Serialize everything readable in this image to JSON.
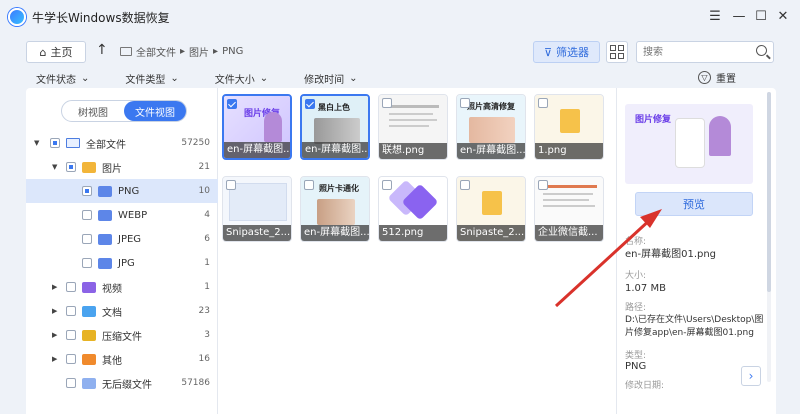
{
  "app": {
    "title": "牛学长Windows数据恢复"
  },
  "window": {
    "menu_icon": "menu-icon",
    "minimize_icon": "minimize-icon",
    "maximize_icon": "maximize-icon",
    "close_icon": "close-icon"
  },
  "nav": {
    "home_label": "主页",
    "breadcrumb": [
      "全部文件",
      "图片",
      "PNG"
    ],
    "filter_label": "筛选器",
    "search_placeholder": "搜索"
  },
  "filters": {
    "items": [
      "文件状态",
      "文件类型",
      "文件大小",
      "修改时间"
    ],
    "reset_label": "重置"
  },
  "view_toggle": {
    "tree_view": "树视图",
    "file_view": "文件视图",
    "active": "file_view"
  },
  "tree": [
    {
      "label": "全部文件",
      "count": "57250",
      "icon": "computer-icon"
    },
    {
      "label": "图片",
      "count": "21",
      "icon": "folder-icon"
    },
    {
      "label": "PNG",
      "count": "10",
      "icon": "folder-icon",
      "selected": true
    },
    {
      "label": "WEBP",
      "count": "4",
      "icon": "folder-icon"
    },
    {
      "label": "JPEG",
      "count": "6",
      "icon": "folder-icon"
    },
    {
      "label": "JPG",
      "count": "1",
      "icon": "folder-icon"
    },
    {
      "label": "视频",
      "count": "1",
      "icon": "video-icon"
    },
    {
      "label": "文档",
      "count": "23",
      "icon": "document-icon"
    },
    {
      "label": "压缩文件",
      "count": "3",
      "icon": "archive-icon"
    },
    {
      "label": "其他",
      "count": "16",
      "icon": "other-icon"
    },
    {
      "label": "无后缀文件",
      "count": "57186",
      "icon": "no-extension-icon"
    }
  ],
  "files": [
    {
      "name": "en-屏幕截图...",
      "checked": true,
      "thumb_text": "图片修复"
    },
    {
      "name": "en-屏幕截图...",
      "checked": true,
      "thumb_text": "黑白上色"
    },
    {
      "name": "联想.png",
      "checked": false,
      "thumb_text": ""
    },
    {
      "name": "en-屏幕截图...",
      "checked": false,
      "thumb_text": "照片高清修复"
    },
    {
      "name": "1.png",
      "checked": false,
      "thumb_text": ""
    },
    {
      "name": "Snipaste_2...",
      "checked": false,
      "thumb_text": ""
    },
    {
      "name": "en-屏幕截图...",
      "checked": false,
      "thumb_text": "照片卡通化"
    },
    {
      "name": "512.png",
      "checked": false,
      "thumb_text": ""
    },
    {
      "name": "Snipaste_2...",
      "checked": false,
      "thumb_text": ""
    },
    {
      "name": "企业微信截...",
      "checked": false,
      "thumb_text": ""
    }
  ],
  "detail": {
    "preview_label": "预览",
    "preview_thumb_text": "图片修复",
    "name_label": "名称:",
    "name_value": "en-屏幕截图01.png",
    "size_label": "大小:",
    "size_value": "1.07 MB",
    "path_label": "路径:",
    "path_value": "D:\\已存在文件\\Users\\Desktop\\图片修复app\\en-屏幕截图01.png",
    "type_label": "类型:",
    "type_value": "PNG",
    "modified_label": "修改日期:"
  },
  "colors": {
    "accent": "#3b78f0",
    "annotation_arrow": "#d9322b"
  }
}
